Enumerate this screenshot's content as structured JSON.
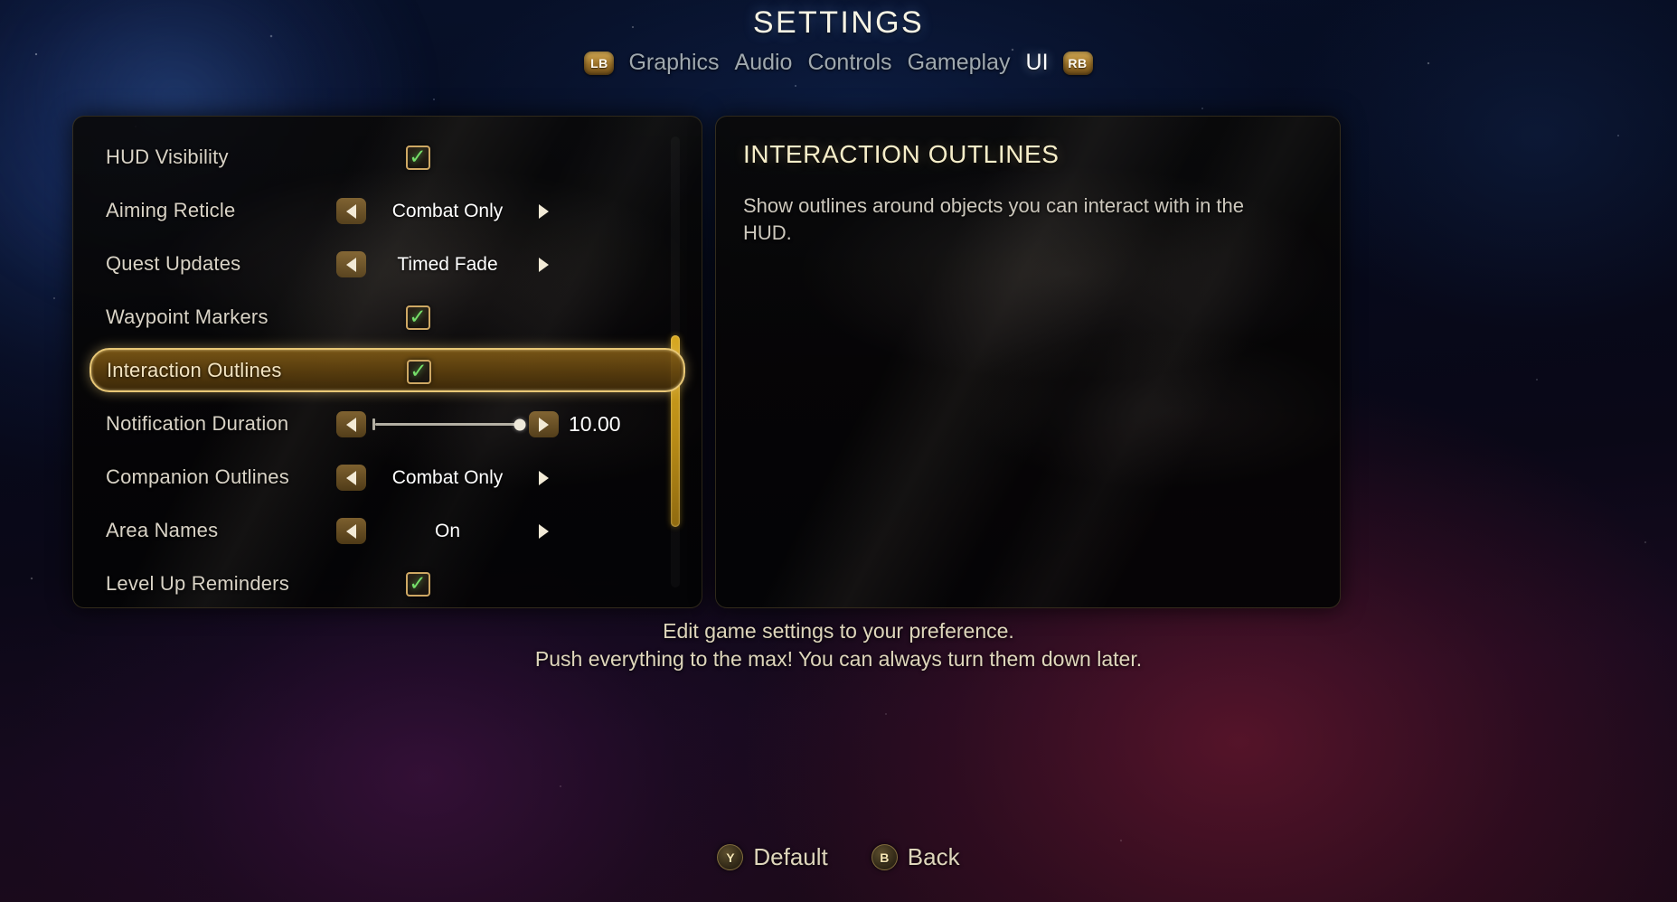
{
  "header": {
    "title": "SETTINGS",
    "shoulder_left": "LB",
    "shoulder_right": "RB",
    "tabs": [
      {
        "label": "Graphics",
        "active": false
      },
      {
        "label": "Audio",
        "active": false
      },
      {
        "label": "Controls",
        "active": false
      },
      {
        "label": "Gameplay",
        "active": false
      },
      {
        "label": "UI",
        "active": true
      }
    ]
  },
  "settings": {
    "rows": [
      {
        "label": "HUD Visibility",
        "type": "checkbox",
        "checked": true,
        "selected": false
      },
      {
        "label": "Aiming Reticle",
        "type": "option",
        "value": "Combat Only",
        "selected": false
      },
      {
        "label": "Quest Updates",
        "type": "option",
        "value": "Timed Fade",
        "selected": false
      },
      {
        "label": "Waypoint Markers",
        "type": "checkbox",
        "checked": true,
        "selected": false
      },
      {
        "label": "Interaction Outlines",
        "type": "checkbox",
        "checked": true,
        "selected": true
      },
      {
        "label": "Notification Duration",
        "type": "slider",
        "value": "10.00",
        "fill_percent": 100,
        "selected": false
      },
      {
        "label": "Companion Outlines",
        "type": "option",
        "value": "Combat Only",
        "selected": false
      },
      {
        "label": "Area Names",
        "type": "option",
        "value": "On",
        "selected": false
      },
      {
        "label": "Level Up Reminders",
        "type": "checkbox",
        "checked": true,
        "selected": false
      }
    ],
    "checkmark_glyph": "✓",
    "scroll_thumb_top_percent": 44
  },
  "description": {
    "title": "INTERACTION OUTLINES",
    "body": "Show outlines around objects you can interact with in the HUD."
  },
  "footer": {
    "hint_line_1": "Edit game settings to your preference.",
    "hint_line_2": "Push everything to the max! You can always turn them down later.",
    "buttons": [
      {
        "pad": "Y",
        "label": "Default"
      },
      {
        "pad": "B",
        "label": "Back"
      }
    ]
  },
  "colors": {
    "accent_gold": "#e8c776",
    "selected_fill": "#7f5a16",
    "check_green": "#76e06a",
    "title_cream": "#f7eec9",
    "scrollbar_gold": "#d8a820"
  }
}
